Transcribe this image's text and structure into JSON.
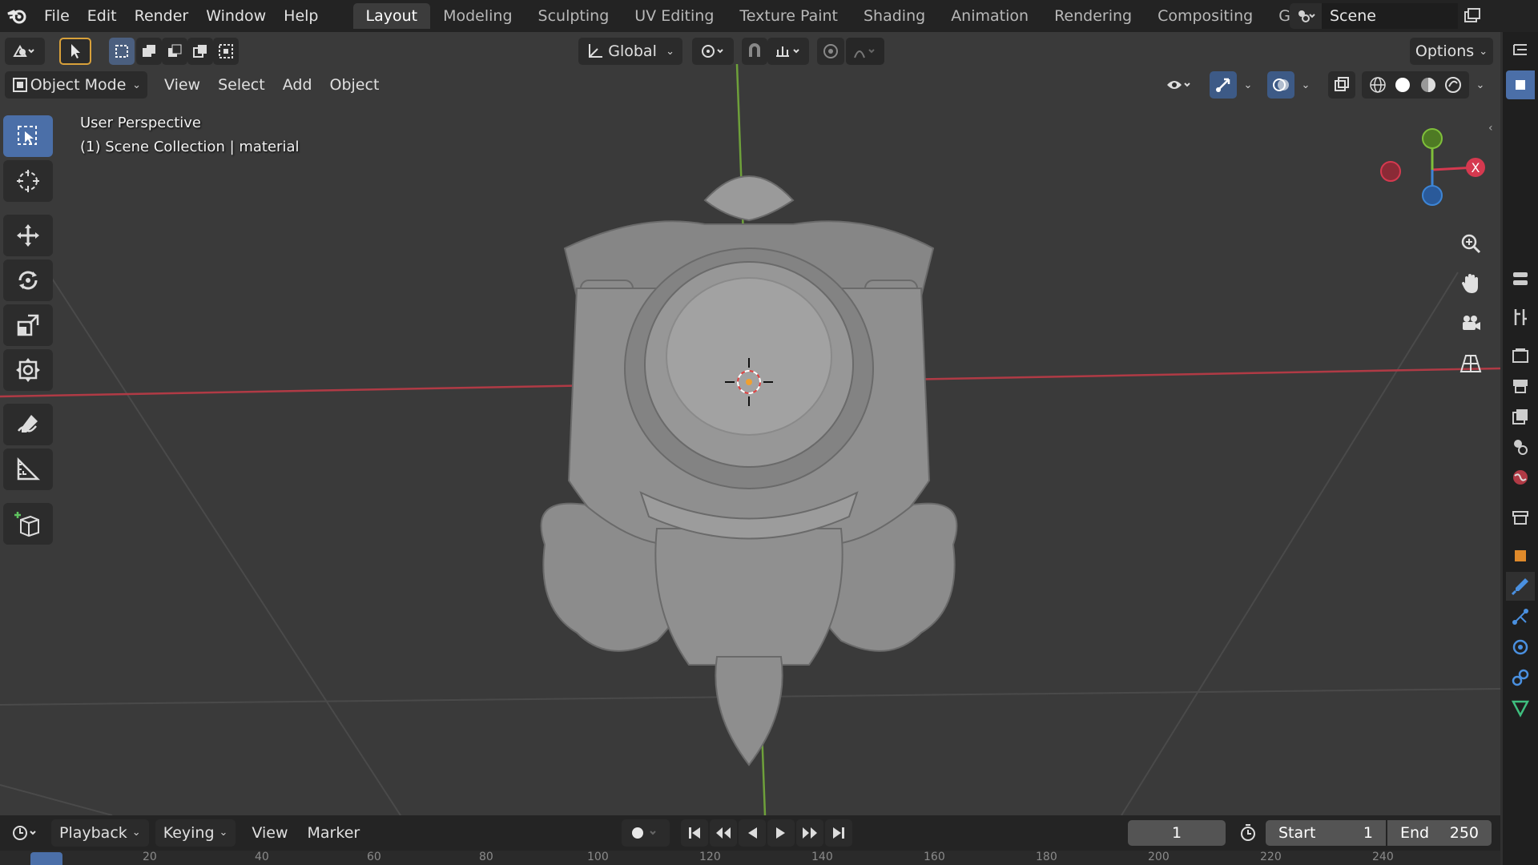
{
  "topbar": {
    "menus": [
      "File",
      "Edit",
      "Render",
      "Window",
      "Help"
    ],
    "workspaces": [
      "Layout",
      "Modeling",
      "Sculpting",
      "UV Editing",
      "Texture Paint",
      "Shading",
      "Animation",
      "Rendering",
      "Compositing",
      "Geometry Nod"
    ],
    "active_workspace": "Layout",
    "scene_name": "Scene"
  },
  "toolheader": {
    "transform_orientation": "Global",
    "options_label": "Options"
  },
  "viewheader": {
    "mode": "Object Mode",
    "menus": [
      "View",
      "Select",
      "Add",
      "Object"
    ]
  },
  "viewport": {
    "perspective_label": "User Perspective",
    "collection_label": "(1) Scene Collection | material",
    "gizmo_axes": {
      "x": "X"
    },
    "colors": {
      "x_axis": "#d5394f",
      "y_axis": "#7fbf3a",
      "z_axis": "#3d85d6",
      "background": "#3a3a3a",
      "active_tool": "#4b6fa8"
    }
  },
  "toolbar": {
    "tools": [
      "select-box-icon",
      "cursor-icon",
      "move-icon",
      "rotate-icon",
      "scale-icon",
      "transform-icon",
      "annotate-icon",
      "measure-icon",
      "add-cube-icon"
    ]
  },
  "timeline": {
    "menus": [
      "Playback",
      "Keying",
      "View",
      "Marker"
    ],
    "current_frame": "1",
    "start_label": "Start",
    "start_value": "1",
    "end_label": "End",
    "end_value": "250",
    "ruler_ticks": [
      "20",
      "40",
      "60",
      "80",
      "100",
      "120",
      "140",
      "160",
      "180",
      "200",
      "220",
      "240"
    ]
  }
}
